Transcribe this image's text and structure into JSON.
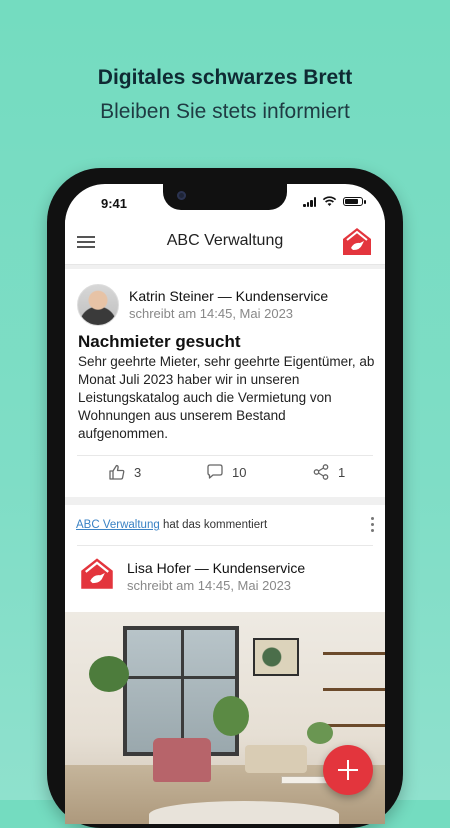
{
  "promo": {
    "title": "Digitales schwarzes Brett",
    "subtitle": "Bleiben Sie stets informiert"
  },
  "status_bar": {
    "time": "9:41"
  },
  "app_bar": {
    "title": "ABC Verwaltung"
  },
  "post": {
    "author": "Katrin Steiner — Kundenservice",
    "meta": "schreibt am 14:45, Mai 2023",
    "title": "Nachmieter gesucht",
    "body": "Sehr geehrte Mieter, sehr geehrte Eigentümer, ab Monat Juli 2023 haber wir in unseren Leistungskatalog auch die Vermietung von Wohnungen aus unserem Bestand aufgenommen.",
    "likes": "3",
    "comments": "10",
    "shares": "1"
  },
  "activity": {
    "actor": "ABC Verwaltung",
    "action": "hat das kommentiert"
  },
  "post2": {
    "author": "Lisa Hofer — Kundenservice",
    "meta": "schreibt am 14:45, Mai 2023"
  },
  "colors": {
    "accent": "#e3353d",
    "background": "#7fddc6",
    "link": "#3a82c4"
  },
  "icons": {
    "menu": "menu-icon",
    "home": "house-icon",
    "like": "thumbs-up-icon",
    "comment": "comment-icon",
    "share": "share-icon",
    "more": "kebab-icon",
    "add": "plus-icon"
  }
}
